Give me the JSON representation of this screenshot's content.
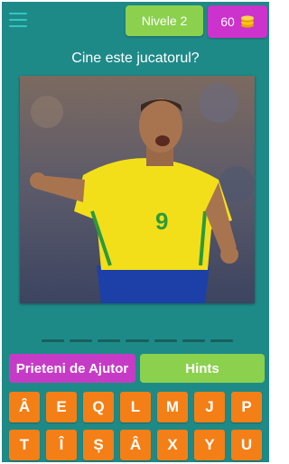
{
  "header": {
    "level_label": "Nivele 2",
    "coins": "60"
  },
  "question": "Cine este jucatorul?",
  "answer_slot_count": 7,
  "buttons": {
    "friends": "Prieteni de Ajutor",
    "hints": "Hints"
  },
  "letters": {
    "row1": [
      "Â",
      "E",
      "Q",
      "L",
      "M",
      "J",
      "P"
    ],
    "row2": [
      "T",
      "Î",
      "Ș",
      "Â",
      "X",
      "Y",
      "U"
    ]
  },
  "colors": {
    "background": "#1e8a88",
    "green": "#8bd14e",
    "purple": "#cc33cc",
    "orange": "#f47f16"
  }
}
